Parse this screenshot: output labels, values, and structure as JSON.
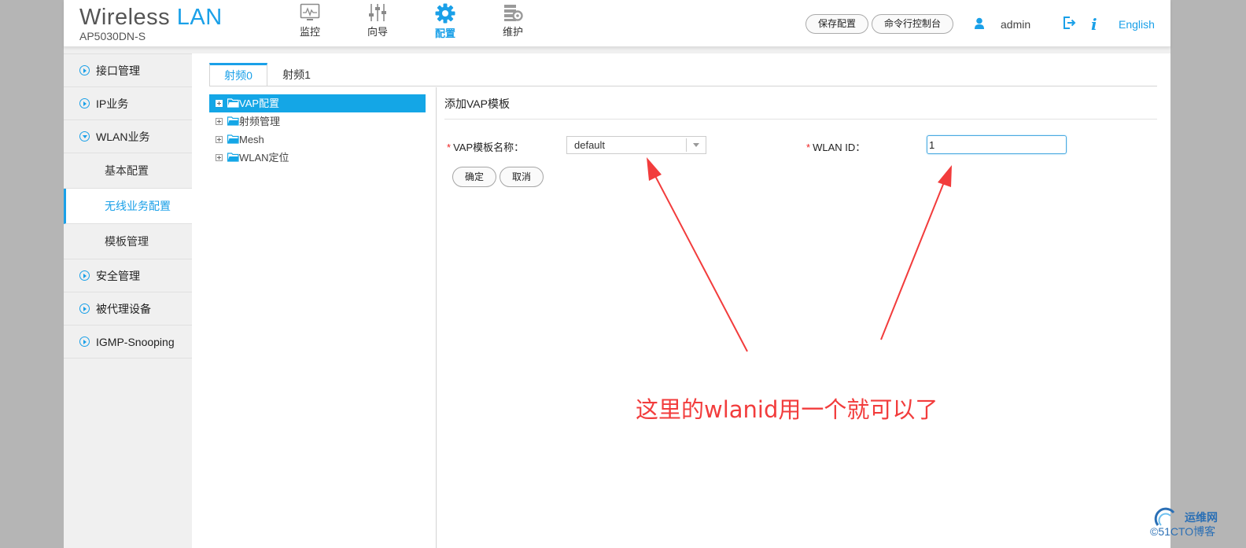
{
  "brand": {
    "name_part1": "Wireless",
    "name_part2": "LAN",
    "model": "AP5030DN-S"
  },
  "nav": [
    {
      "label": "监控",
      "icon": "monitor-icon"
    },
    {
      "label": "向导",
      "icon": "sliders-icon"
    },
    {
      "label": "配置",
      "icon": "gear-icon",
      "active": true
    },
    {
      "label": "维护",
      "icon": "maintenance-icon"
    }
  ],
  "header": {
    "save_config": "保存配置",
    "cli_console": "命令行控制台",
    "user": "admin",
    "info": "i",
    "language": "English"
  },
  "sidebar": {
    "items": [
      {
        "label": "接口管理"
      },
      {
        "label": "IP业务"
      },
      {
        "label": "WLAN业务",
        "expanded": true
      }
    ],
    "sub_items": [
      {
        "label": "基本配置"
      },
      {
        "label": "无线业务配置",
        "active": true
      },
      {
        "label": "模板管理"
      }
    ],
    "items_after": [
      {
        "label": "安全管理"
      },
      {
        "label": "被代理设备"
      },
      {
        "label": "IGMP-Snooping"
      }
    ]
  },
  "tabs": [
    {
      "label": "射频0",
      "active": true
    },
    {
      "label": "射频1"
    }
  ],
  "tree": [
    {
      "label": "VAP配置",
      "selected": true
    },
    {
      "label": "射频管理"
    },
    {
      "label": "Mesh"
    },
    {
      "label": "WLAN定位"
    }
  ],
  "form": {
    "title": "添加VAP模板",
    "required_mark": "*",
    "vap_label": "VAP模板名称：",
    "vap_value": "default",
    "wlan_label": "WLAN ID：",
    "wlan_value": "1",
    "ok_button": "确定",
    "cancel_button": "取消"
  },
  "annotation": "这里的wlanid用一个就可以了",
  "watermark": {
    "line1": "运维网",
    "line2": "©51CTO博客"
  },
  "colors": {
    "accent": "#1aa0e8",
    "annotation": "#f23c3c",
    "tree_selected": "#14a6e6"
  }
}
